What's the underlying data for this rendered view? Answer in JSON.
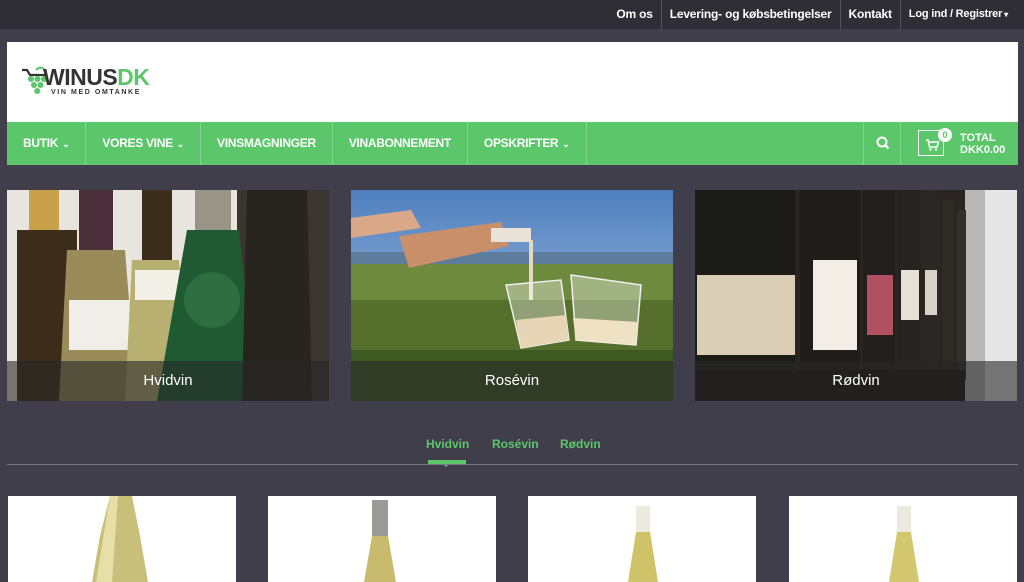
{
  "topbar": {
    "links": [
      "Om os",
      "Levering- og købsbetingelser",
      "Kontakt"
    ],
    "account": "Log ind / Registrer"
  },
  "logo": {
    "brand_main": "WINUS",
    "brand_accent": "DK",
    "tagline": "VIN MED OMTANKE"
  },
  "nav": {
    "items": [
      {
        "label": "BUTIK",
        "dropdown": true
      },
      {
        "label": "VORES VINE",
        "dropdown": true
      },
      {
        "label": "VINSMAGNINGER",
        "dropdown": false
      },
      {
        "label": "VINABONNEMENT",
        "dropdown": false
      },
      {
        "label": "OPSKRIFTER",
        "dropdown": true
      }
    ],
    "cart_count": "0",
    "cart_total_label": "TOTAL",
    "cart_total_value": "DKK0.00"
  },
  "categories": [
    {
      "label": "Hvidvin"
    },
    {
      "label": "Rosévin"
    },
    {
      "label": "Rødvin"
    }
  ],
  "tabs": [
    {
      "label": "Hvidvin",
      "active": true
    },
    {
      "label": "Rosévin",
      "active": false
    },
    {
      "label": "Rødvin",
      "active": false
    }
  ],
  "colors": {
    "accent": "#5cc76a",
    "topbar": "#2f2e36",
    "background": "#403e4a"
  },
  "icons": [
    "grape-logo-icon",
    "search-icon",
    "cart-icon",
    "chevron-down-icon"
  ]
}
